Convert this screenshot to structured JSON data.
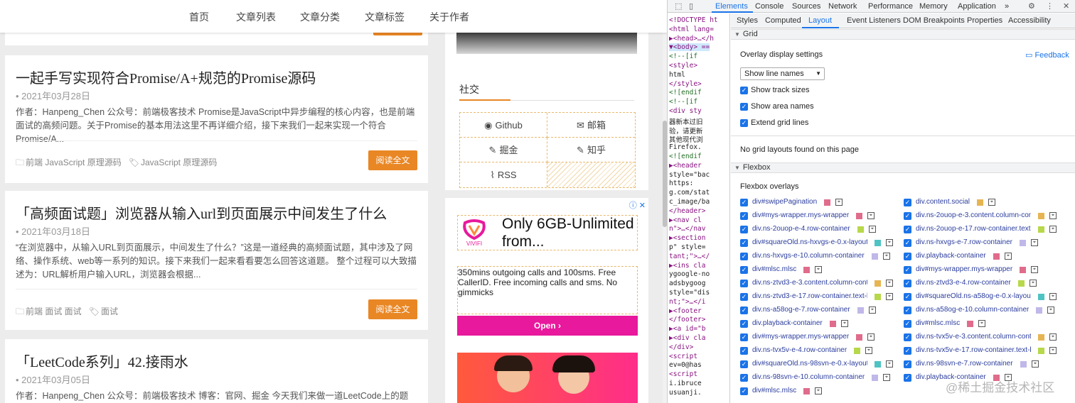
{
  "nav": {
    "items": [
      "首页",
      "文章列表",
      "文章分类",
      "文章标签",
      "关于作者"
    ]
  },
  "articles": [
    {
      "title": "一起手写实现符合Promise/A+规范的Promise源码",
      "date": "2021年03月28日",
      "excerpt": "作者：Hanpeng_Chen 公众号：前端极客技术 Promise是JavaScript中异步编程的核心内容，也是前端面试的高频问题。关于Promise的基本用法这里不再详细介绍，接下来我们一起来实现一个符合 Promise/A...",
      "category": "前端 JavaScript 原理源码",
      "tags": "JavaScript  原理源码",
      "read_more": "阅读全文"
    },
    {
      "title": "「高频面试题」浏览器从输入url到页面展示中间发生了什么",
      "date": "2021年03月18日",
      "excerpt": "“在浏览器中，从输入URL到页面展示，中间发生了什么？”这是一道经典的高频面试题，其中涉及了网络、操作系统、web等一系列的知识。接下来我们一起来看看要怎么回答这道题。 整个过程可以大致描述为：URL解析用户输入URL，浏览器会根据...",
      "category": "前端 面试 面试",
      "tags": "面试",
      "read_more": "阅读全文"
    },
    {
      "title": "「LeetCode系列」42.接雨水",
      "date": "2021年03月05日",
      "excerpt": "作者：Hanpeng_Chen 公众号：前端极客技术 博客：官网、掘金 今天我们来做一道LeetCode上的题目，原"
    }
  ],
  "social": {
    "heading": "社交",
    "links": [
      "Github",
      "邮箱",
      "掘金",
      "知乎",
      "RSS"
    ]
  },
  "ad": {
    "brand": "VIVIFI",
    "title": "Only 6GB-Unlimited from...",
    "body": "350mins outgoing calls and 100sms. Free CallerID. Free incoming calls and sms. No gimmicks",
    "button": "Open",
    "close": "ⓘ ✕"
  },
  "devtools": {
    "tabs": [
      "Elements",
      "Console",
      "Sources",
      "Network",
      "Performance",
      "Memory",
      "Application"
    ],
    "more": "»",
    "subtabs": [
      "Styles",
      "Computed",
      "Layout",
      "Event Listeners",
      "DOM Breakpoints",
      "Properties",
      "Accessibility"
    ],
    "elements_lines": [
      "<!DOCTYPE ht",
      "<html lang=",
      "▶<head>…</h",
      "▼<body> ==",
      "  <!--[if",
      "  <style>",
      "    html",
      "  </style>",
      "  <![endif",
      "  <!--[if",
      "  <div sty",
      "  器新本过旧",
      "  验，请更新",
      "  其他现代浏",
      "  Firefox.",
      "  <![endif",
      " ▶<header",
      " style=\"bac",
      "    https:",
      " g.com/stat",
      " c_image/ba",
      " </header>",
      " ▶<nav cl",
      " n\">…</nav",
      " ▶<section",
      " p\" style=",
      " tant;\">…</",
      " ▶<ins cla",
      " ygoogle-no",
      " adsbygoog",
      " style=\"dis",
      " nt;\">…</i",
      " ▶<footer",
      "  </footer>",
      " ▶<a id=\"b",
      " ▶<div cla",
      " </div>",
      "  <script",
      "  ev=0@has",
      "  <script",
      "  i.ibruce",
      "  usuanji."
    ],
    "grid_section": "Grid",
    "overlay_title": "Overlay display settings",
    "feedback": "Feedback",
    "select_value": "Show line names",
    "checkboxes": [
      "Show track sizes",
      "Show area names",
      "Extend grid lines"
    ],
    "no_grid": "No grid layouts found on this page",
    "flexbox_section": "Flexbox",
    "flexbox_overlays": "Flexbox overlays",
    "flex_left": [
      {
        "label": "div#swipePagination",
        "color": "#e06c8c"
      },
      {
        "label": "div#mys-wrapper.mys-wrapper",
        "color": "#e06c8c"
      },
      {
        "label": "div.ns-2ouop-e-4.row-container",
        "color": "#b7d84a"
      },
      {
        "label": "div#squareOld.ns-hxvgs-e-0.x-layout.c...",
        "color": "#4fc3c3"
      },
      {
        "label": "div.ns-hxvgs-e-10.column-container",
        "color": "#c0b8e8"
      },
      {
        "label": "div#mlsc.mlsc",
        "color": "#e06c8c"
      },
      {
        "label": "div.ns-ztvd3-e-3.content.column-conta...",
        "color": "#e6b552"
      },
      {
        "label": "div.ns-ztvd3-e-17.row-container.text-b...",
        "color": "#b7d84a"
      },
      {
        "label": "div.ns-a58og-e-7.row-container",
        "color": "#c0b8e8"
      },
      {
        "label": "div.playback-container",
        "color": "#e06c8c"
      },
      {
        "label": "div#mys-wrapper.mys-wrapper",
        "color": "#e06c8c"
      },
      {
        "label": "div.ns-tvx5v-e-4.row-container",
        "color": "#b7d84a"
      },
      {
        "label": "div#squareOld.ns-98svn-e-0.x-layout.c...",
        "color": "#4fc3c3"
      },
      {
        "label": "div.ns-98svn-e-10.column-container",
        "color": "#c0b8e8"
      },
      {
        "label": "div#mlsc.mlsc",
        "color": "#e06c8c"
      }
    ],
    "flex_right": [
      {
        "label": "div.content.social",
        "color": "#e6b552"
      },
      {
        "label": "div.ns-2ouop-e-3.content.column-cont...",
        "color": "#e6b552"
      },
      {
        "label": "div.ns-2ouop-e-17.row-container.text-...",
        "color": "#b7d84a"
      },
      {
        "label": "div.ns-hxvgs-e-7.row-container",
        "color": "#c0b8e8"
      },
      {
        "label": "div.playback-container",
        "color": "#e06c8c"
      },
      {
        "label": "div#mys-wrapper.mys-wrapper",
        "color": "#e06c8c"
      },
      {
        "label": "div.ns-ztvd3-e-4.row-container",
        "color": "#b7d84a"
      },
      {
        "label": "div#squareOld.ns-a58og-e-0.x-layout.c...",
        "color": "#4fc3c3"
      },
      {
        "label": "div.ns-a58og-e-10.column-container",
        "color": "#c0b8e8"
      },
      {
        "label": "div#mlsc.mlsc",
        "color": "#e06c8c"
      },
      {
        "label": "div.ns-tvx5v-e-3.content.column-conta...",
        "color": "#e6b552"
      },
      {
        "label": "div.ns-tvx5v-e-17.row-container.text-b...",
        "color": "#b7d84a"
      },
      {
        "label": "div.ns-98svn-e-7.row-container",
        "color": "#c0b8e8"
      },
      {
        "label": "div.playback-container",
        "color": "#e06c8c"
      }
    ]
  },
  "watermark": "@稀土掘金技术社区"
}
